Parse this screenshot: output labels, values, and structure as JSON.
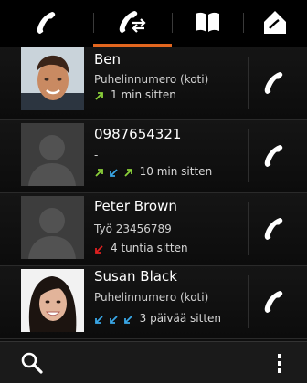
{
  "tabs": [
    {
      "icon": "phone-icon",
      "selected": false
    },
    {
      "icon": "call-log-icon",
      "selected": true
    },
    {
      "icon": "book-icon",
      "selected": false
    },
    {
      "icon": "home-icon",
      "selected": false
    }
  ],
  "colors": {
    "accent": "#e2661f",
    "outgoing_arrow": "#8bd13a",
    "incoming_arrow": "#3aa8e8",
    "missed_arrow": "#e02020"
  },
  "calls": [
    {
      "name": "Ben",
      "detail": "Puhelinnumero (koti)",
      "time": "1 min sitten",
      "arrows": [
        "outgoing"
      ]
    },
    {
      "name": "0987654321",
      "detail": "-",
      "time": "10 min sitten",
      "arrows": [
        "outgoing",
        "incoming",
        "outgoing"
      ]
    },
    {
      "name": "Peter Brown",
      "detail": "Työ 23456789",
      "time": "4 tuntia sitten",
      "arrows": [
        "missed"
      ]
    },
    {
      "name": "Susan Black",
      "detail": "Puhelinnumero (koti)",
      "time": "3 päivää sitten",
      "arrows": [
        "incoming",
        "incoming",
        "incoming"
      ]
    }
  ],
  "bottom": {
    "search_icon": "search-icon",
    "menu_icon": "overflow-menu-icon"
  }
}
